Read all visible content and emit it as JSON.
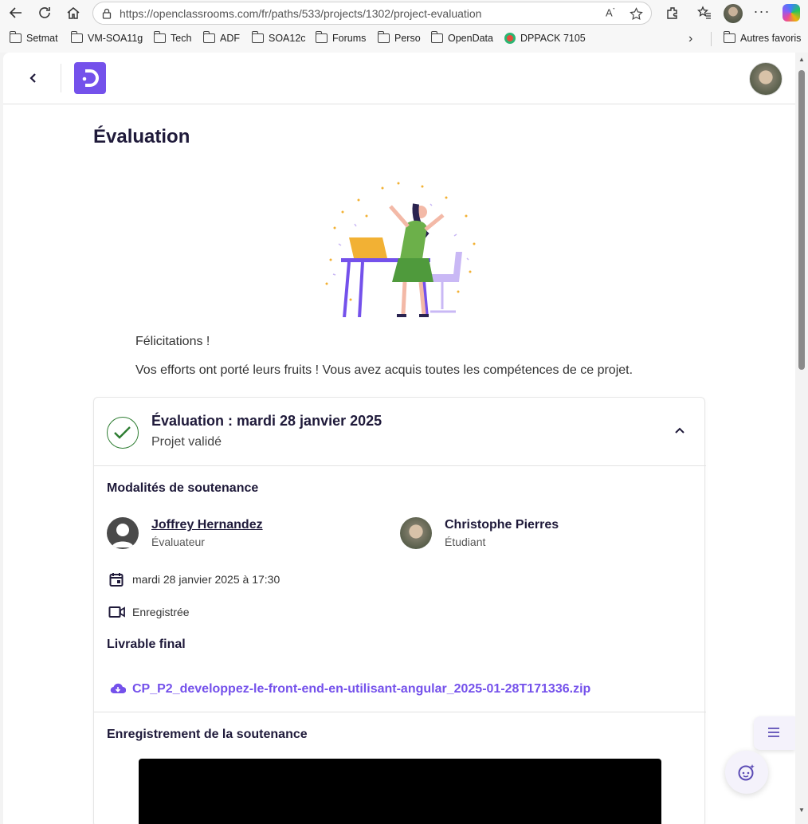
{
  "browser": {
    "url": "https://openclassrooms.com/fr/paths/533/projects/1302/project-evaluation",
    "bookmarks": [
      {
        "label": "Setmat",
        "icon": "folder-icon"
      },
      {
        "label": "VM-SOA11g",
        "icon": "folder-icon"
      },
      {
        "label": "Tech",
        "icon": "folder-icon"
      },
      {
        "label": "ADF",
        "icon": "folder-icon"
      },
      {
        "label": "SOA12c",
        "icon": "folder-icon"
      },
      {
        "label": "Forums",
        "icon": "folder-icon"
      },
      {
        "label": "Perso",
        "icon": "folder-icon"
      },
      {
        "label": "OpenData",
        "icon": "folder-icon"
      },
      {
        "label": "DPPACK 7105",
        "icon": "site-icon"
      }
    ],
    "other_favorites": "Autres favoris"
  },
  "page": {
    "title": "Évaluation",
    "congrats": "Félicitations !",
    "message": "Vos efforts ont porté leurs fruits ! Vous avez acquis toutes les compétences de ce projet."
  },
  "evaluation": {
    "heading": "Évaluation : mardi 28 janvier 2025",
    "status": "Projet validé",
    "modalities_title": "Modalités de soutenance",
    "evaluator": {
      "name": "Joffrey Hernandez",
      "role": "Évaluateur"
    },
    "student": {
      "name": "Christophe Pierres",
      "role": "Étudiant"
    },
    "date": "mardi 28 janvier 2025 à 17:30",
    "recording_status": "Enregistrée",
    "deliverable_title": "Livrable final",
    "deliverable_file": "CP_P2_developpez-le-front-end-en-utilisant-angular_2025-01-28T171336.zip",
    "recording_title": "Enregistrement de la soutenance"
  },
  "colors": {
    "accent": "#7451eb",
    "success": "#2e7d32",
    "text": "#1f1a3a"
  }
}
